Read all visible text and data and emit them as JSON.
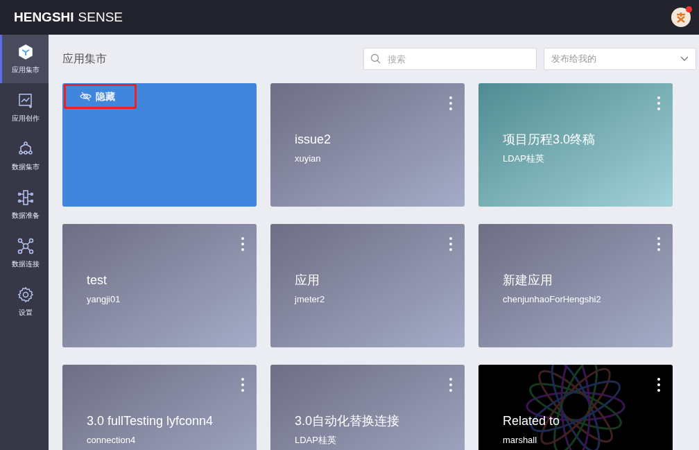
{
  "header": {
    "logo_bold": "HENGSHI",
    "logo_light": "SENSE",
    "avatar": {
      "notification": true
    }
  },
  "sidebar": {
    "items": [
      {
        "label": "应用集市",
        "kind": "cube",
        "selected": true
      },
      {
        "label": "应用创作",
        "kind": "chart",
        "selected": false
      },
      {
        "label": "数据集市",
        "kind": "hub",
        "selected": false
      },
      {
        "label": "数据准备",
        "kind": "prep",
        "selected": false
      },
      {
        "label": "数据连接",
        "kind": "connect",
        "selected": false
      },
      {
        "label": "设置",
        "kind": "gear",
        "selected": false
      }
    ]
  },
  "page_title": "应用集市",
  "search": {
    "placeholder": "搜索"
  },
  "filter": {
    "value": "发布给我的"
  },
  "cards": [
    {
      "kind": "blue",
      "badge": "隐藏",
      "highlighted": true
    },
    {
      "kind": "gray",
      "title": "issue2",
      "owner": "xuyian"
    },
    {
      "kind": "teal",
      "title": "项目历程3.0终稿",
      "owner": "LDAP桂英"
    },
    {
      "kind": "gray",
      "title": "test",
      "owner": "yangji01"
    },
    {
      "kind": "gray",
      "title": "应用",
      "owner": "jmeter2"
    },
    {
      "kind": "gray",
      "title": "新建应用",
      "owner": "chenjunhaoForHengshi2"
    },
    {
      "kind": "gray",
      "title": "3.0 fullTesting lyfconn4",
      "owner": "connection4"
    },
    {
      "kind": "gray",
      "title": "3.0自动化替换连接",
      "owner": "LDAP桂英"
    },
    {
      "kind": "image",
      "title": "Related to",
      "owner": "marshall"
    }
  ]
}
